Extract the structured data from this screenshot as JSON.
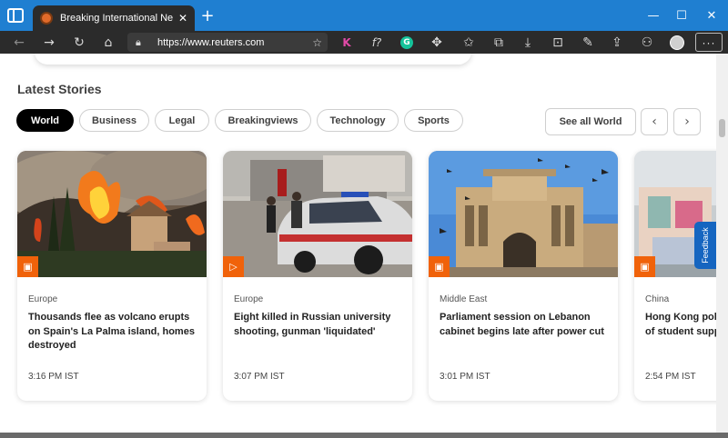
{
  "browser": {
    "tab_title": "Breaking International News & V",
    "url": "https://www.reuters.com",
    "window_controls": {
      "minimize": "—",
      "maximize": "☐",
      "close": "✕"
    },
    "icons": [
      "back-icon",
      "forward-icon",
      "refresh-icon",
      "home-icon",
      "lock-icon",
      "favorite-add-icon",
      "k-extension-icon",
      "formula-extension-icon",
      "grammarly-icon",
      "puzzle-icon",
      "favorites-icon",
      "collections-icon",
      "download-icon",
      "screenshot-icon",
      "notes-icon",
      "share-icon",
      "extensions-icon",
      "profile-icon",
      "more-icon"
    ],
    "k_label": "K",
    "f_label": "f?",
    "g_label": "G",
    "more_label": "···"
  },
  "section": {
    "title": "Latest Stories"
  },
  "chips": [
    {
      "label": "World",
      "active": true
    },
    {
      "label": "Business",
      "active": false
    },
    {
      "label": "Legal",
      "active": false
    },
    {
      "label": "Breakingviews",
      "active": false
    },
    {
      "label": "Technology",
      "active": false
    },
    {
      "label": "Sports",
      "active": false
    }
  ],
  "see_all_label": "See all World",
  "cards": [
    {
      "category": "Europe",
      "headline": "Thousands flee as volcano erupts on Spain's La Palma island, homes destroyed",
      "time": "3:16 PM IST",
      "media": "image-icon"
    },
    {
      "category": "Europe",
      "headline": "Eight killed in Russian university shooting, gunman 'liquidated'",
      "time": "3:07 PM IST",
      "media": "play-icon"
    },
    {
      "category": "Middle East",
      "headline": "Parliament session on Lebanon cabinet begins late after power cut",
      "time": "3:01 PM IST",
      "media": "image-icon"
    },
    {
      "category": "China",
      "headline": "Hong Kong police arrest members of student support group",
      "time": "2:54 PM IST",
      "media": "image-icon"
    }
  ],
  "feedback_label": "Feedback",
  "colors": {
    "brand_orange": "#f0620a",
    "titlebar": "#1f7fd1",
    "feedback": "#1565c0"
  }
}
